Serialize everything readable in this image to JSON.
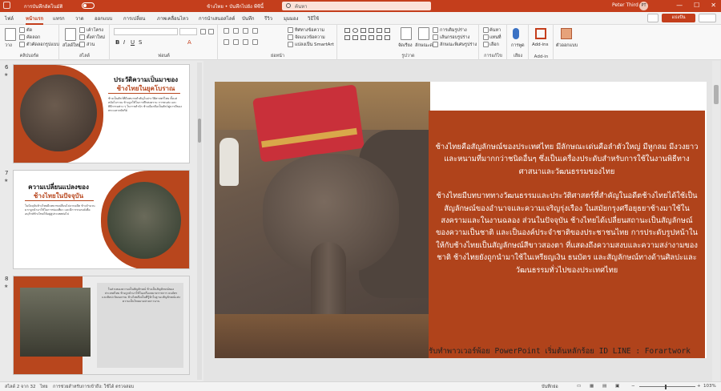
{
  "titlebar": {
    "autosave_label": "การบันทึกอัตโนมัติ",
    "doc_title": "ช้างไทย • บันทึกไปยัง พีซีนี้",
    "search_placeholder": "ค้นหา",
    "user_name": "Peter Third",
    "user_initials": "PT",
    "minimize": "—",
    "maximize": "☐",
    "close": "✕"
  },
  "tabs": [
    "ไฟล์",
    "หน้าแรก",
    "แทรก",
    "วาด",
    "ออกแบบ",
    "การเปลี่ยน",
    "ภาพเคลื่อนไหว",
    "การนำเสนอสไลด์",
    "บันทึก",
    "รีวิว",
    "มุมมอง",
    "วิธีใช้"
  ],
  "active_tab": "หน้าแรก",
  "share_label": "แบ่งปัน",
  "ribbon": {
    "clipboard": {
      "paste": "วาง",
      "cut": "ตัด",
      "copy": "คัดลอก",
      "format_painter": "ตัวคัดลอกรูปแบบ",
      "label": "คลิปบอร์ด"
    },
    "slides": {
      "new_slide": "สไลด์ใหม่",
      "layout": "เค้าโครง",
      "reset": "ตั้งค่าใหม่",
      "section": "ส่วน",
      "label": "สไลด์"
    },
    "font": {
      "label": "ฟอนต์"
    },
    "paragraph": {
      "text_direction": "ทิศทางข้อความ",
      "align_text": "จัดแนวข้อความ",
      "smartart": "แปลงเป็น SmartArt",
      "label": "ย่อหน้า"
    },
    "drawing": {
      "arrange": "จัดเรียง",
      "quick_styles": "ลักษณะด่วน",
      "fill": "การเติมรูปร่าง",
      "outline": "เส้นกรอบรูปร่าง",
      "effects": "ลักษณะพิเศษรูปร่าง",
      "label": "รูปวาด"
    },
    "editing": {
      "find": "ค้นหา",
      "replace": "แทนที่",
      "select": "เลือก",
      "label": "การแก้ไข"
    },
    "voice": {
      "dictate": "การพูด",
      "label": "เสียง"
    },
    "addins": {
      "addins": "Add-ins",
      "label": "Add-in"
    },
    "designer": {
      "designer": "ตัวออกแบบ"
    }
  },
  "slides": [
    {
      "number": "6",
      "title": "ประวัติความเป็นมาของ",
      "subtitle": "ช้างไทยในยุคโบราณ",
      "body": "ช้างเป็นสัตว์ที่มีบทบาทสำคัญในประวัติศาสตร์ไทย ตั้งแต่สมัยโบราณ ช้างถูกใช้ในการศึกสงคราม การขนส่ง และพิธีกรรมต่าง ๆ ในราชสำนัก ช้างเผือกถือเป็นสัตว์คู่บารมีของพระมหากษัตริย์"
    },
    {
      "number": "7",
      "title": "ความเปลี่ยนแปลงของ",
      "subtitle": "ช้างไทยในปัจจุบัน",
      "body": "ในปัจจุบันช้างไทยมีบทบาทเปลี่ยนไปจากอดีต ช้างจำนวนมากถูกนำมาใช้ในการท่องเที่ยว และมีการรณรงค์เพื่ออนุรักษ์ช้างไทยให้อยู่คู่ประเทศต่อไป"
    },
    {
      "number": "8",
      "body": "ในส่วนของความเป็นสัญลักษณ์ ช้างเป็นสัญลักษณ์ของประเทศไทย ช้างถูกนำมาใช้ในเครื่องหมายราชการ ธนบัตร และศิลปะวัฒนธรรม ช้างไทยจึงเป็นที่รู้จักในฐานะสัญลักษณ์แห่งความเป็นไทยมาอย่างยาวนาน"
    }
  ],
  "main_slide": {
    "paragraph1": "ช้างไทยคือสัญลักษณ์ของประเทศไทย มีลักษณะเด่นคือลำตัวใหญ่ มีหูกลม มีงวงยาว และหนามที่มากกว่าชนิดอื่นๆ ซึ่งเป็นเครื่องประดับสำหรับการใช้ในงานพิธีทางศาสนาและวัฒนธรรมของไทย",
    "paragraph2": "ช้างไทยมีบทบาททางวัฒนธรรมและประวัติศาสตร์ที่สำคัญในอดีตช้างไทยได้ใช้เป็นสัญลักษณ์ของอำนาจและความเจริญรุ่งเรือง ในสมัยกรุงศรีอยุธยาช้างมาใช้ในสงครามและในงานฉลอง ส่วนในปัจจุบัน ช้างไทยได้เปลี่ยนสถานะเป็นสัญลักษณ์ของความเป็นชาติ และเป็นองค์ประจำชาติของประชาชนไทย การประดับรูปหน้าในให้กับช้างไทยเป็นสัญลักษณ์สีขาวสองตา ที่แสดงถึงความสงบและความสง่างามของชาติ ช้างไทยยังถูกนำมาใช้ในเหรียญเงิน ธนบัตร และสัญลักษณ์ทางด้านศิลปะและวัฒนธรรมทั่วไปของประเทศไทย"
  },
  "footer_note": "รับทำพาวเวอร์พ้อย PowerPoint เริ่มต้นหลักร้อย ID LINE : Forartwork",
  "statusbar": {
    "slide_info": "สไลด์ 2 จาก 32",
    "language": "ไทย",
    "accessibility": "การช่วยสำหรับการเข้าถึง: ใช้ได้ ตรวจสอบ",
    "notes": "บันทึกย่อ",
    "zoom": "103%"
  }
}
